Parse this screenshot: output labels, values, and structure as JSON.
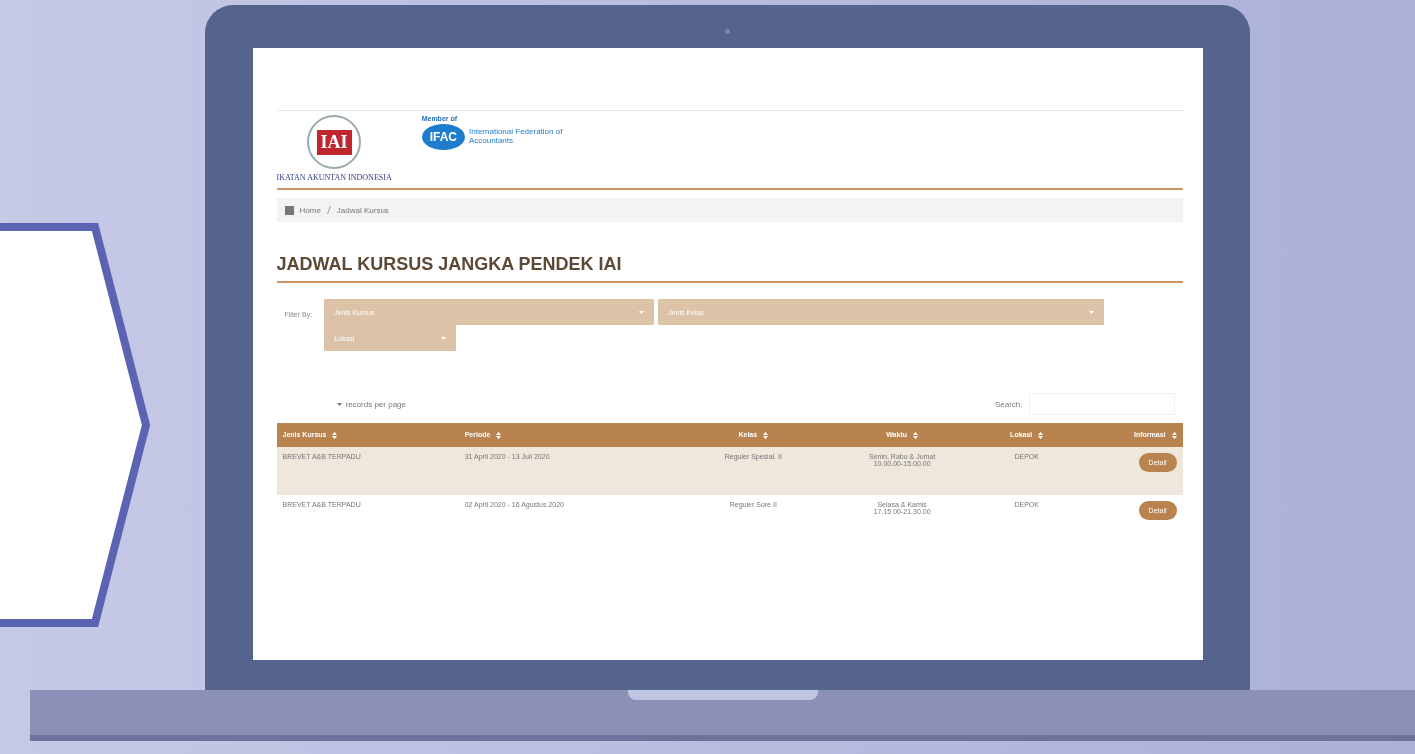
{
  "header": {
    "logo_text": "IAI",
    "org_name": "IKATAN AKUNTAN INDONESIA",
    "member_label": "Member of",
    "partner_logo_text": "IFAC",
    "partner_name": "International Federation of Accountants"
  },
  "breadcrumb": [
    {
      "label": "Home",
      "kind": "home"
    },
    {
      "label": "Jadwal Kursus",
      "kind": "current"
    }
  ],
  "page_title": "JADWAL KURSUS JANGKA PENDEK IAI",
  "filter": {
    "label": "Filter By:",
    "selects": [
      {
        "placeholder": "Jenis Kursus"
      },
      {
        "placeholder": "Jenis Kelas"
      },
      {
        "placeholder": "Lokasi"
      }
    ]
  },
  "length_control": {
    "label": "records per page"
  },
  "search": {
    "label": "Search:"
  },
  "table": {
    "columns": [
      "Jenis Kursus",
      "Periode",
      "Kelas",
      "Waktu",
      "Lokasi",
      "Informasi"
    ],
    "rows": [
      {
        "jenis": "BREVET A&B TERPADU",
        "periode": "31 April 2020 - 13 Juli 2020",
        "kelas": "Reguler Spesial. II",
        "waktu": [
          "Senin, Rabu & Jumat",
          "10.00.00-15.00.00"
        ],
        "lokasi": "DEPOK",
        "action": "Detail",
        "selected": true
      },
      {
        "jenis": "BREVET A&B TERPADU",
        "periode": "02 April 2020 - 16 Agustus 2020",
        "kelas": "Reguler Sore II",
        "waktu": [
          "Selasa & Kamis",
          "17.15.00-21.30.00"
        ],
        "lokasi": "DEPOK",
        "action": "Detail",
        "selected": false
      }
    ]
  }
}
